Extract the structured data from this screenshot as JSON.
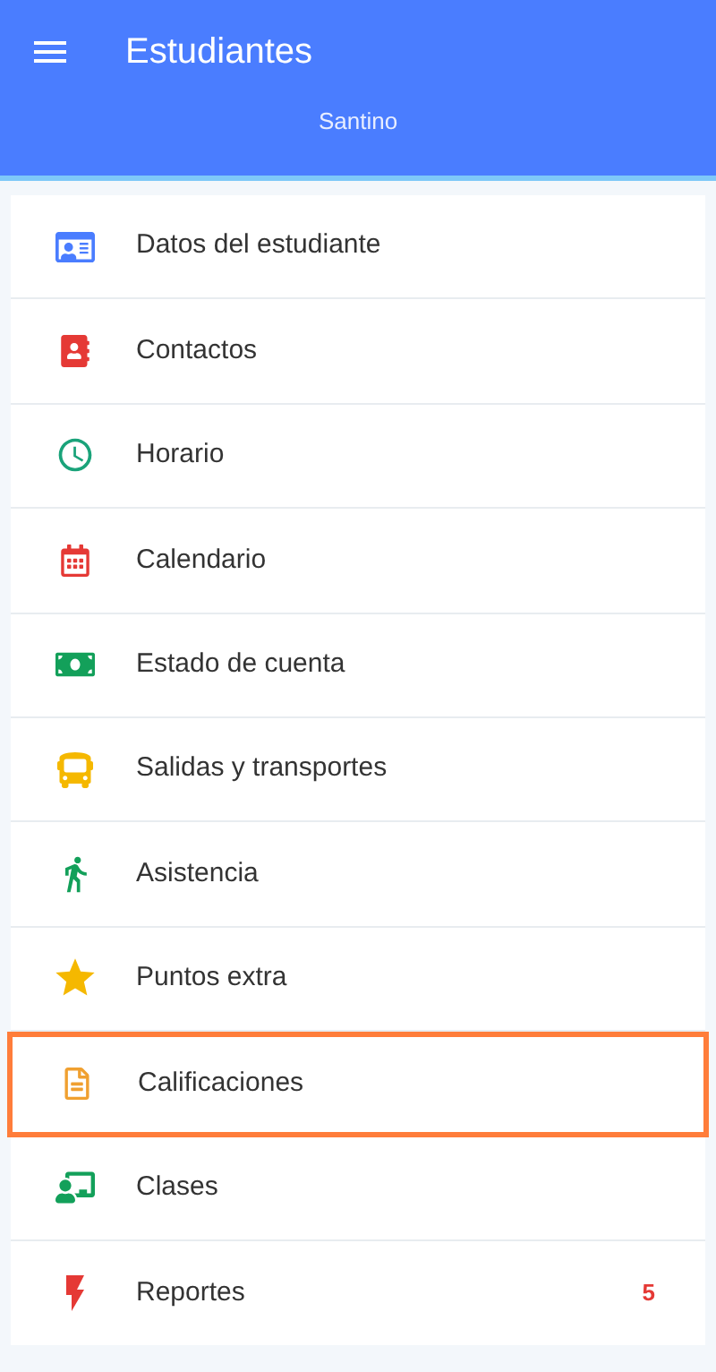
{
  "header": {
    "title": "Estudiantes",
    "subtitle": "Santino"
  },
  "menu": [
    {
      "label": "Datos del estudiante",
      "selected": false
    },
    {
      "label": "Contactos",
      "selected": false
    },
    {
      "label": "Horario",
      "selected": false
    },
    {
      "label": "Calendario",
      "selected": false
    },
    {
      "label": "Estado de cuenta",
      "selected": false
    },
    {
      "label": "Salidas y transportes",
      "selected": false
    },
    {
      "label": "Asistencia",
      "selected": false
    },
    {
      "label": "Puntos extra",
      "selected": false
    },
    {
      "label": "Calificaciones",
      "selected": true
    },
    {
      "label": "Clases",
      "selected": false
    },
    {
      "label": "Reportes",
      "selected": false,
      "count": "5"
    }
  ]
}
